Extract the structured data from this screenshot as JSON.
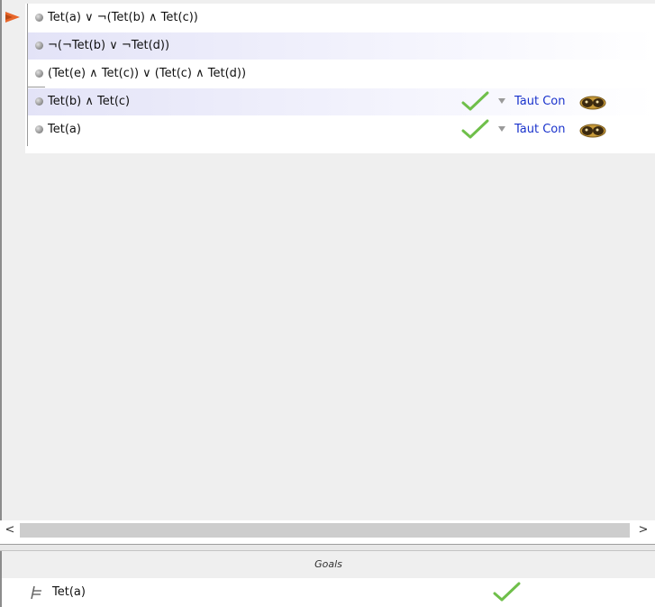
{
  "proof": {
    "steps": [
      {
        "formula": "Tet(a) ∨ ¬(Tet(b) ∧ Tet(c))",
        "shaded": false,
        "checked": false
      },
      {
        "formula": "¬(¬Tet(b) ∨ ¬Tet(d))",
        "shaded": true,
        "checked": false
      },
      {
        "formula": "(Tet(e) ∧ Tet(c)) ∨ (Tet(c) ∧ Tet(d))",
        "shaded": false,
        "checked": false
      },
      {
        "formula": "Tet(b) ∧ Tet(c)",
        "shaded": true,
        "checked": true,
        "rule": "Taut Con",
        "support_icon": "eyes-icon"
      },
      {
        "formula": "Tet(a)",
        "shaded": false,
        "checked": true,
        "rule": "Taut Con",
        "support_icon": "eyes-icon"
      }
    ]
  },
  "scrollbar": {
    "left_arrow": "<",
    "right_arrow": ">"
  },
  "goals": {
    "title": "Goals",
    "items": [
      {
        "formula": "Tet(a)",
        "checked": true
      }
    ]
  },
  "colors": {
    "focus_arrow": "#e8662a",
    "rule_text": "#1a33cc",
    "check": "#6fbf4a",
    "pane_background": "#efefef"
  }
}
